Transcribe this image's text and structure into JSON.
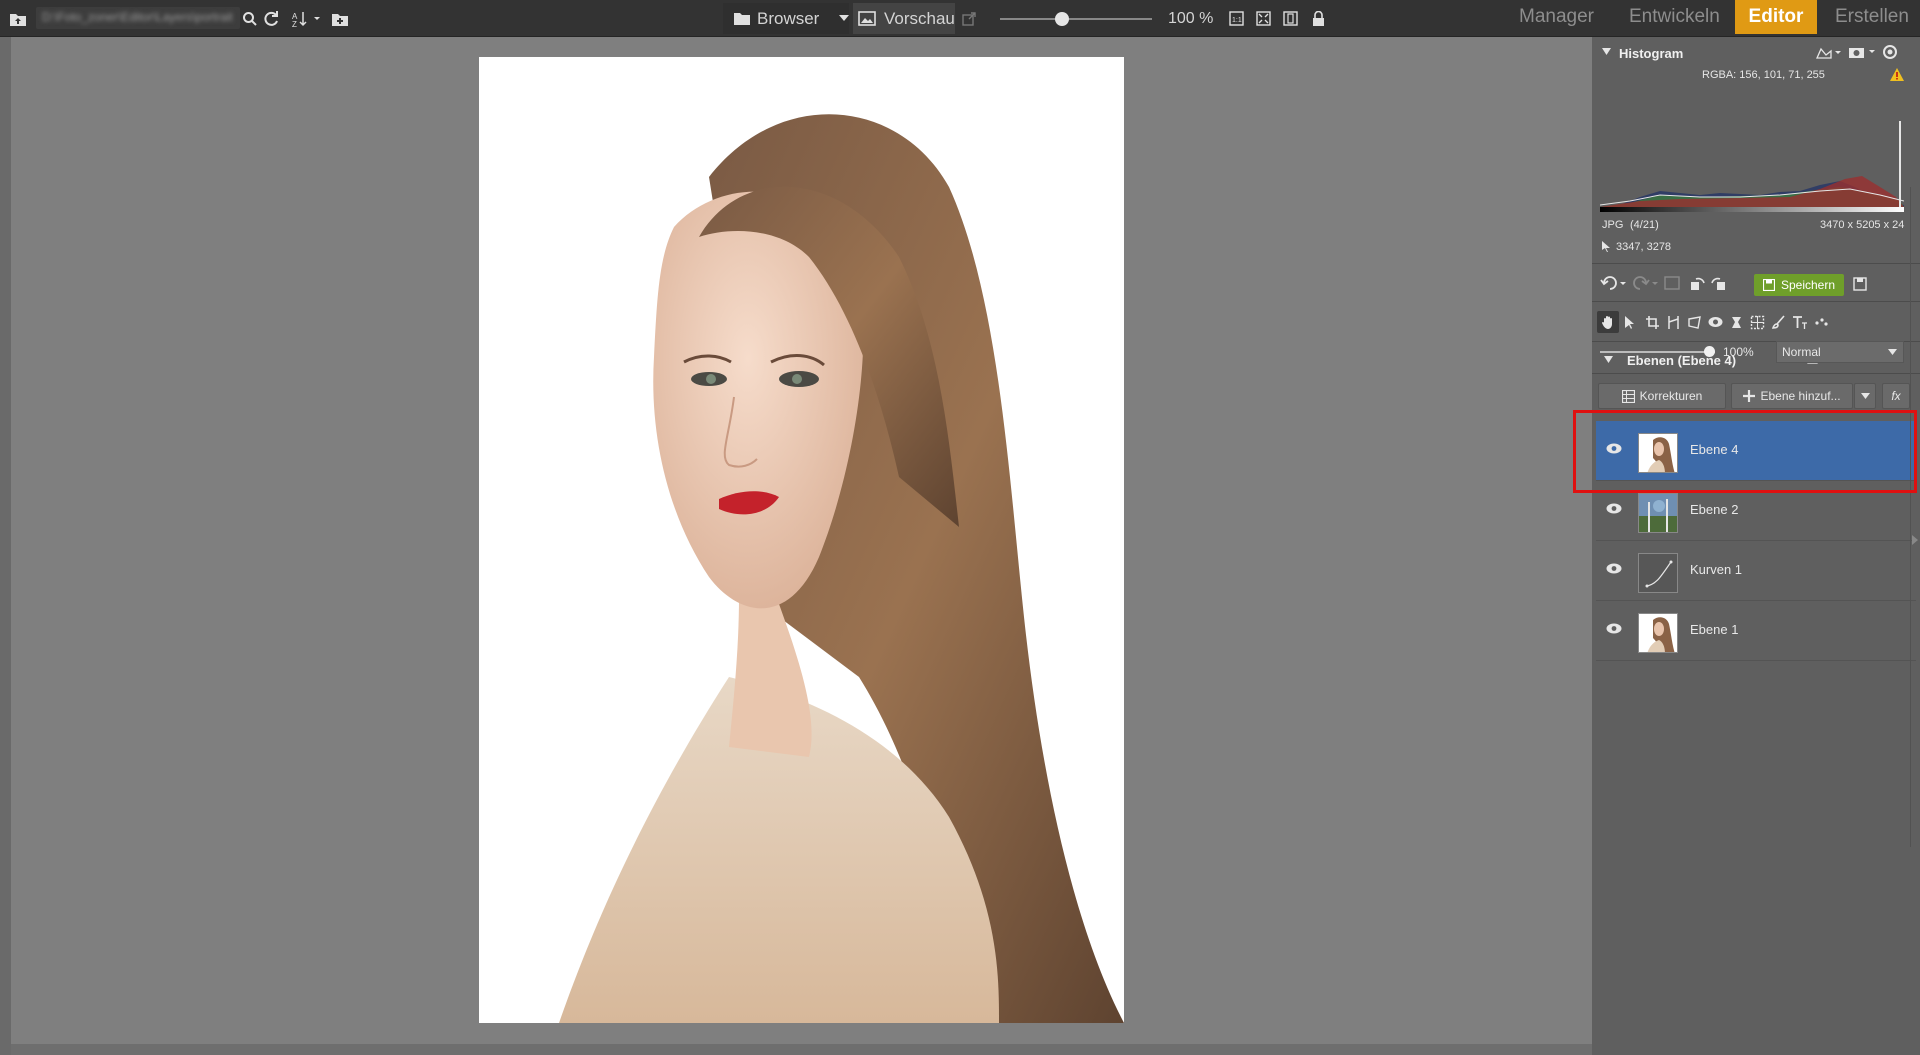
{
  "topbar": {
    "path_text": "D:\\Foto_zoner\\Editor\\Layers\\portrait",
    "browser_label": "Browser",
    "preview_label": "Vorschau",
    "zoom_value": "100 %",
    "zoom_level_fraction": 0.45,
    "modes": {
      "manager": "Manager",
      "develop": "Entwickeln",
      "editor": "Editor",
      "create": "Erstellen"
    },
    "accent_color": "#e09a14"
  },
  "histogram": {
    "title": "Histogram",
    "rgba_readout": "RGBA: 156, 101,  71, 255",
    "file_format": "JPG",
    "file_index": "(4/21)",
    "dimensions": "3470 x 5205 x 24",
    "cursor_position": "3347, 3278"
  },
  "toolbar": {
    "save_label": "Speichern",
    "save_color": "#6f9f2a"
  },
  "layers": {
    "title": "Ebenen (Ebene 4)",
    "opacity_value": "100%",
    "opacity_fraction": 1.0,
    "blend_mode": "Normal",
    "corrections_label": "Korrekturen",
    "add_layer_label": "Ebene hinzuf...",
    "fx_label": "fx",
    "active_color": "#3d6aa8",
    "items": [
      {
        "name": "Ebene 4",
        "active": true,
        "thumb": "portrait"
      },
      {
        "name": "Ebene 2",
        "active": false,
        "thumb": "landscape"
      },
      {
        "name": "Kurven 1",
        "active": false,
        "thumb": "curves"
      },
      {
        "name": "Ebene 1",
        "active": false,
        "thumb": "portrait"
      }
    ]
  },
  "annotation": {
    "highlight_color": "#e01010"
  }
}
